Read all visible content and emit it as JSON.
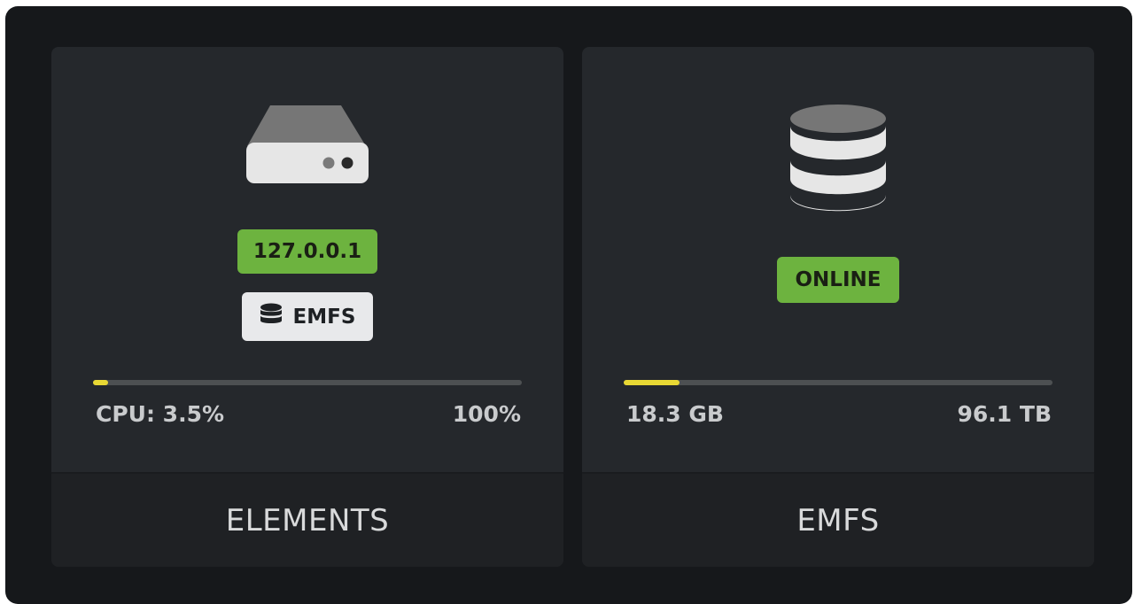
{
  "cards": [
    {
      "icon": "server-drive-icon",
      "address_badge": "127.0.0.1",
      "type_badge": {
        "icon": "database-icon",
        "label": "EMFS"
      },
      "progress": {
        "fraction": 0.035,
        "left_label": "CPU: 3.5%",
        "right_label": "100%"
      },
      "footer_title": "ELEMENTS"
    },
    {
      "icon": "database-icon",
      "status_badge": "ONLINE",
      "progress": {
        "fraction": 0.13,
        "left_label": "18.3 GB",
        "right_label": "96.1 TB"
      },
      "footer_title": "EMFS"
    }
  ],
  "colors": {
    "background": "#16181b",
    "card": "#25282c",
    "badge_green": "#6db33f",
    "bar_fill": "#e8d834",
    "bar_track": "#4d5052"
  }
}
